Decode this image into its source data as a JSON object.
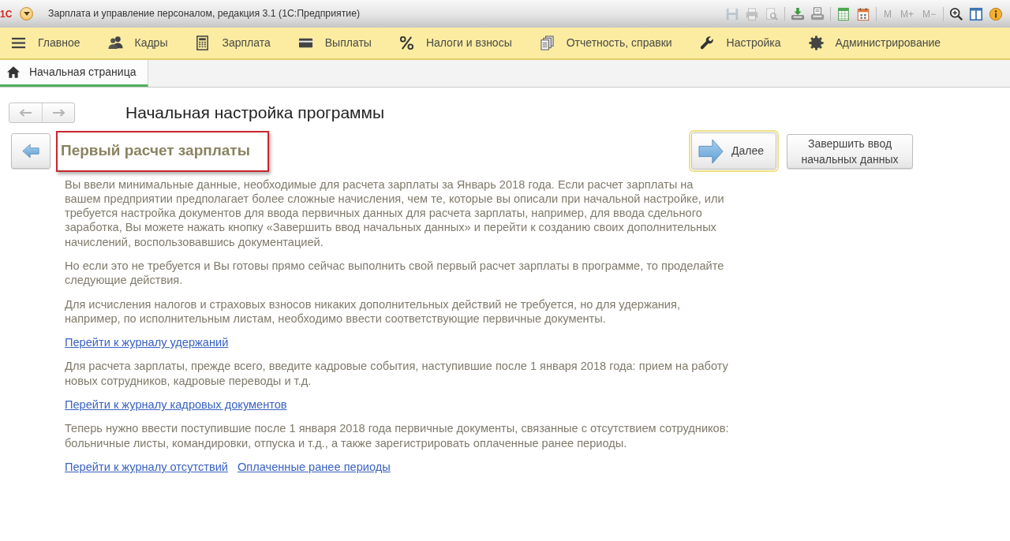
{
  "window": {
    "logo": "1С",
    "title": "Зарплата и управление персоналом, редакция 3.1 (1С:Предприятие)"
  },
  "toolbar": {
    "groups": [
      [
        {
          "kind": "icon",
          "disabled": true
        },
        {
          "kind": "icon",
          "disabled": true
        },
        {
          "kind": "icon",
          "disabled": true
        }
      ],
      [
        {
          "kind": "icon",
          "disabled": false
        },
        {
          "kind": "icon",
          "disabled": false
        }
      ],
      [
        {
          "kind": "icon",
          "disabled": false
        },
        {
          "kind": "icon",
          "disabled": false
        }
      ],
      [
        {
          "kind": "text",
          "label": "M",
          "disabled": true
        },
        {
          "kind": "text",
          "label": "M+",
          "disabled": true
        },
        {
          "kind": "text",
          "label": "M−",
          "disabled": true
        }
      ],
      [
        {
          "kind": "icon",
          "disabled": false
        },
        {
          "kind": "icon",
          "disabled": false
        },
        {
          "kind": "icon",
          "disabled": false
        }
      ]
    ]
  },
  "sections": [
    "Главное",
    "Кадры",
    "Зарплата",
    "Выплаты",
    "Налоги и взносы",
    "Отчетность, справки",
    "Настройка",
    "Администрирование"
  ],
  "tabs": [
    {
      "label": "Начальная страница",
      "selected": true
    }
  ],
  "form": {
    "title": "Начальная настройка программы",
    "history_buttons": [
      {
        "disabled": true
      },
      {
        "disabled": true
      }
    ],
    "step": {
      "heading": "Первый расчет зарплаты",
      "highlighted": true
    },
    "buttons": [
      {
        "kind": "next",
        "label": "Далее",
        "focused": true
      },
      {
        "kind": "finish",
        "label": "Завершить ввод начальных данных",
        "focused": false
      }
    ],
    "blocks": [
      {
        "kind": "text",
        "text": "Вы ввели минимальные данные, необходимые для расчета зарплаты за Январь 2018 года. Если расчет зарплаты на вашем предприятии предполагает более сложные начисления, чем те, которые вы описали при начальной настройке, или требуется настройка документов для ввода первичных данных для расчета зарплаты, например, для ввода сдельного заработка, Вы можете нажать кнопку «Завершить ввод начальных данных» и перейти к созданию своих дополнительных начислений, воспользовавшись документацией."
      },
      {
        "kind": "text",
        "text": "Но если это не требуется и Вы готовы прямо сейчас выполнить свой первый расчет зарплаты в программе, то проделайте следующие действия."
      },
      {
        "kind": "text",
        "text": "Для исчисления налогов и страховых взносов никаких дополнительных действий не требуется, но для удержания, например, по исполнительным листам, необходимо ввести соответствующие первичные документы."
      },
      {
        "kind": "links",
        "links": [
          "Перейти к журналу удержаний"
        ]
      },
      {
        "kind": "text",
        "text": "Для расчета зарплаты, прежде всего, введите кадровые события, наступившие после 1 января 2018 года: прием на работу новых сотрудников, кадровые переводы и т.д."
      },
      {
        "kind": "links",
        "links": [
          "Перейти к журналу кадровых документов"
        ]
      },
      {
        "kind": "text",
        "text": "Теперь нужно ввести поступившие после 1 января 2018 года первичные документы, связанные с отсутствием сотрудников: больничные листы, командировки, отпуска и т.д., а также зарегистрировать оплаченные ранее периоды."
      },
      {
        "kind": "links",
        "links": [
          "Перейти к журналу отсутствий",
          "Оплаченные ранее периоды"
        ]
      }
    ]
  }
}
